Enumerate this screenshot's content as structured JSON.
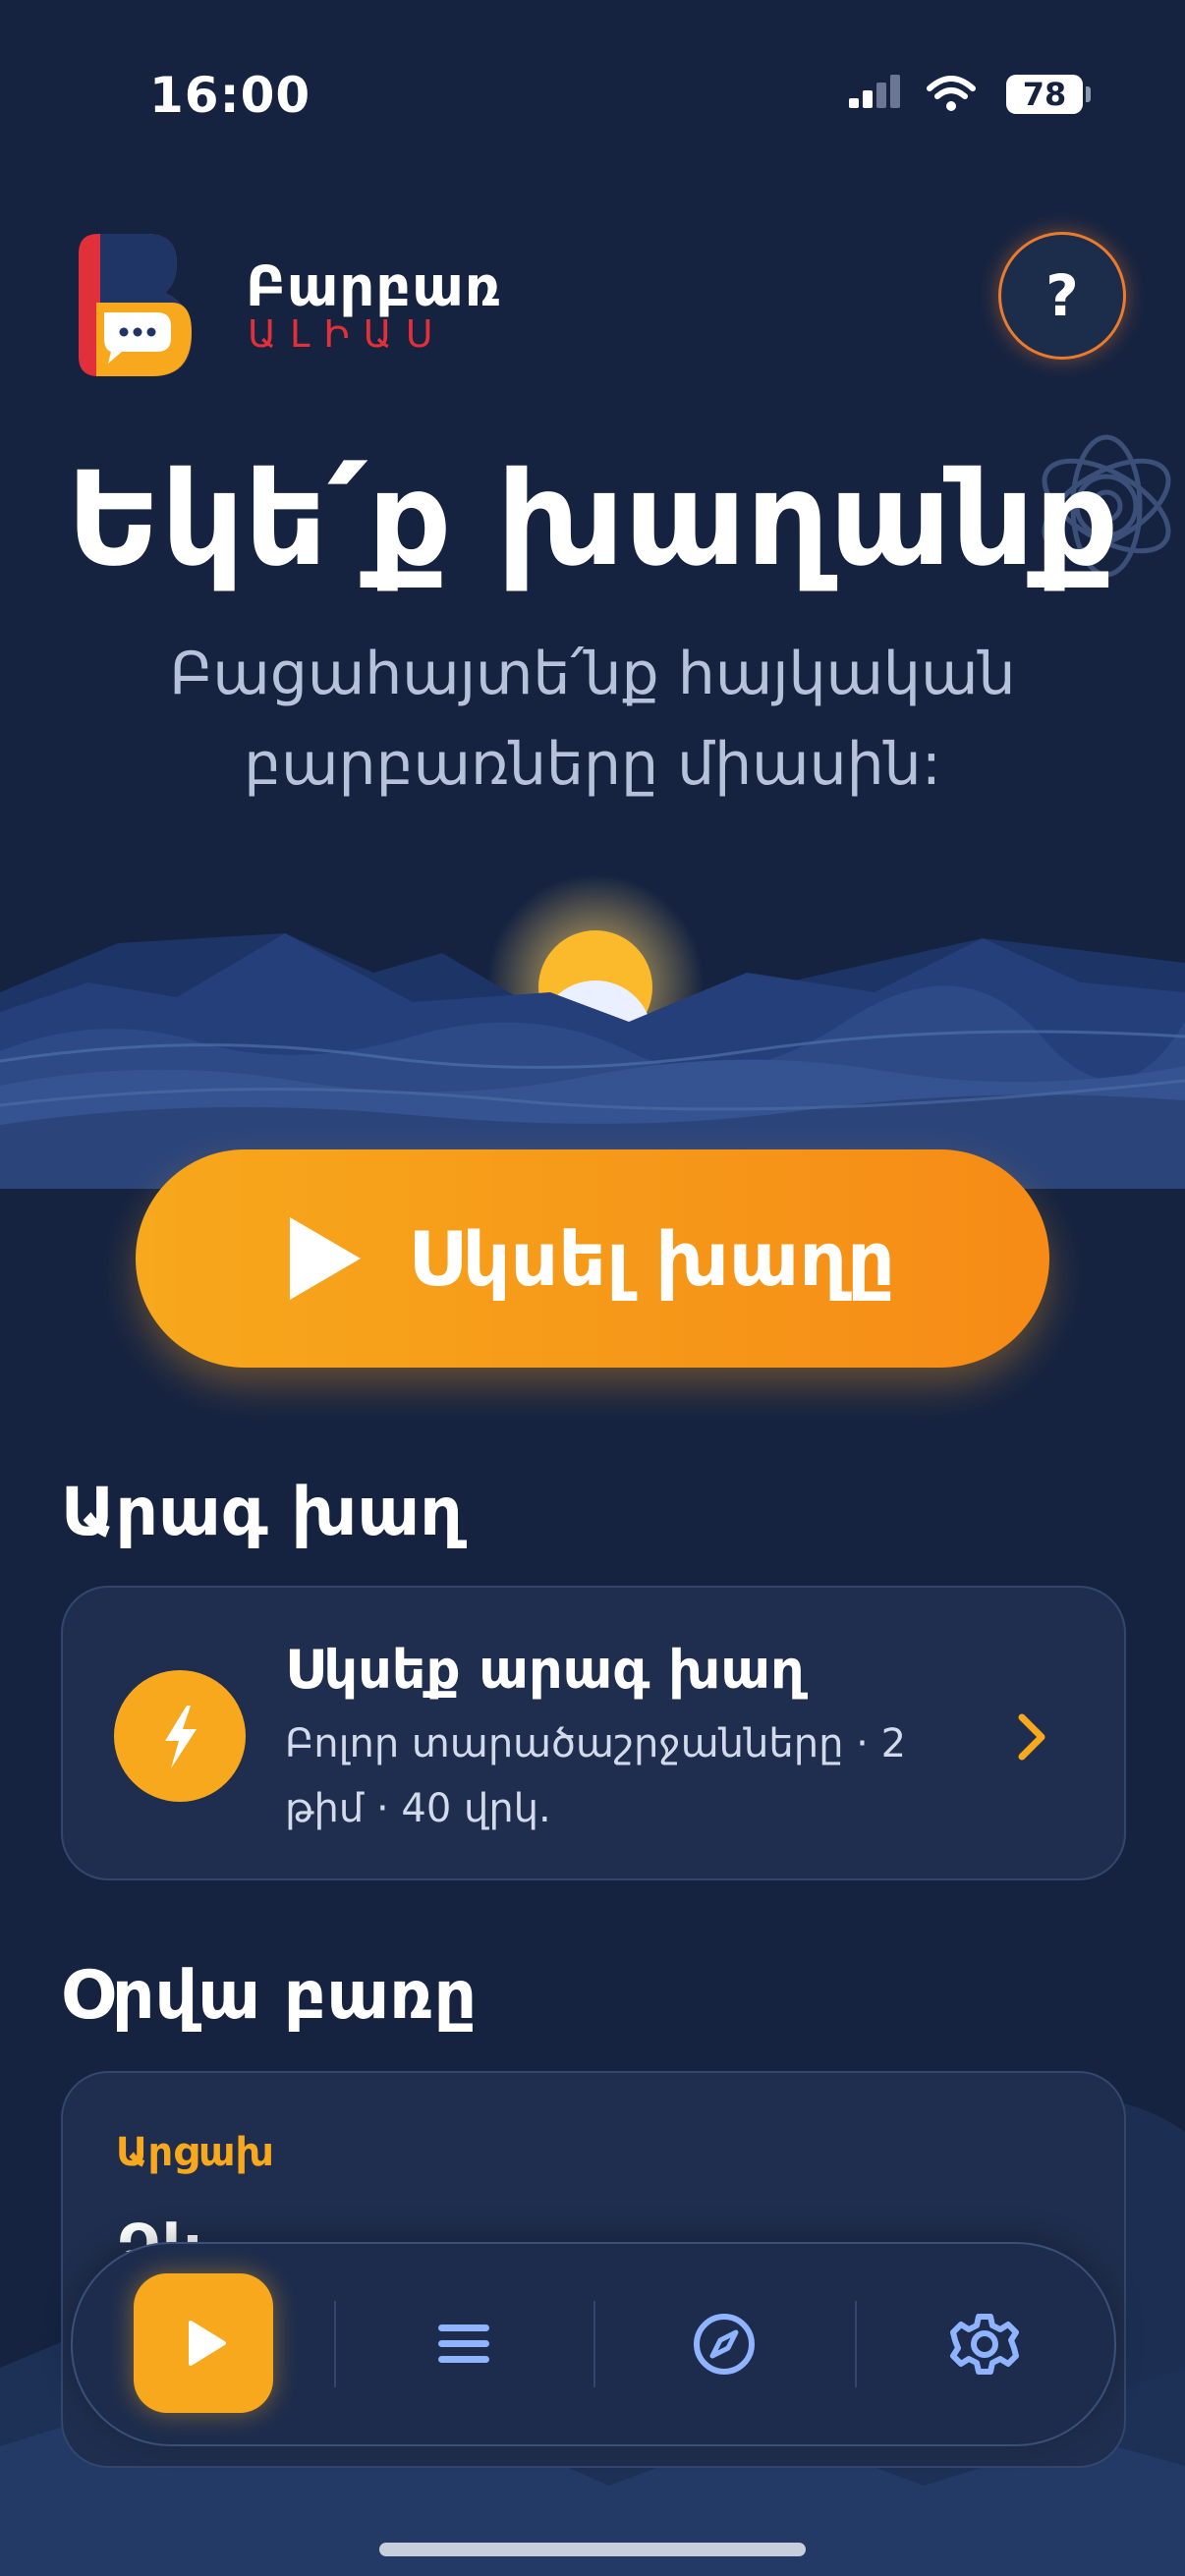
{
  "status_bar": {
    "time": "16:00",
    "battery": "78"
  },
  "brand": {
    "name": "Բարբառ",
    "subtitle": "ԱԼԻԱՍ"
  },
  "help": {
    "label": "?"
  },
  "hero": {
    "title": "Եկե՛ք խաղանք",
    "subtitle": "Բացահայտե՛նք հայկական բարբառները միասին:"
  },
  "start_button": {
    "label": "Սկսել խաղը"
  },
  "quick_game": {
    "section_title": "Արագ խաղ",
    "title": "Սկսեք արագ խաղ",
    "description": "Բոլոր տարածաշրջանները · 2 թիմ · 40 վրկ."
  },
  "word_of_day": {
    "section_title": "Օրվա բառը",
    "region": "Արցախ",
    "word": "Ձև ․․․ ․․․"
  },
  "tab_bar": {
    "items": [
      {
        "icon": "play-icon",
        "active": true
      },
      {
        "icon": "menu-icon",
        "active": false
      },
      {
        "icon": "compass-icon",
        "active": false
      },
      {
        "icon": "gear-icon",
        "active": false
      }
    ]
  },
  "colors": {
    "background": "#152341",
    "accent": "#f7a81c",
    "brand_red": "#e1303a"
  }
}
